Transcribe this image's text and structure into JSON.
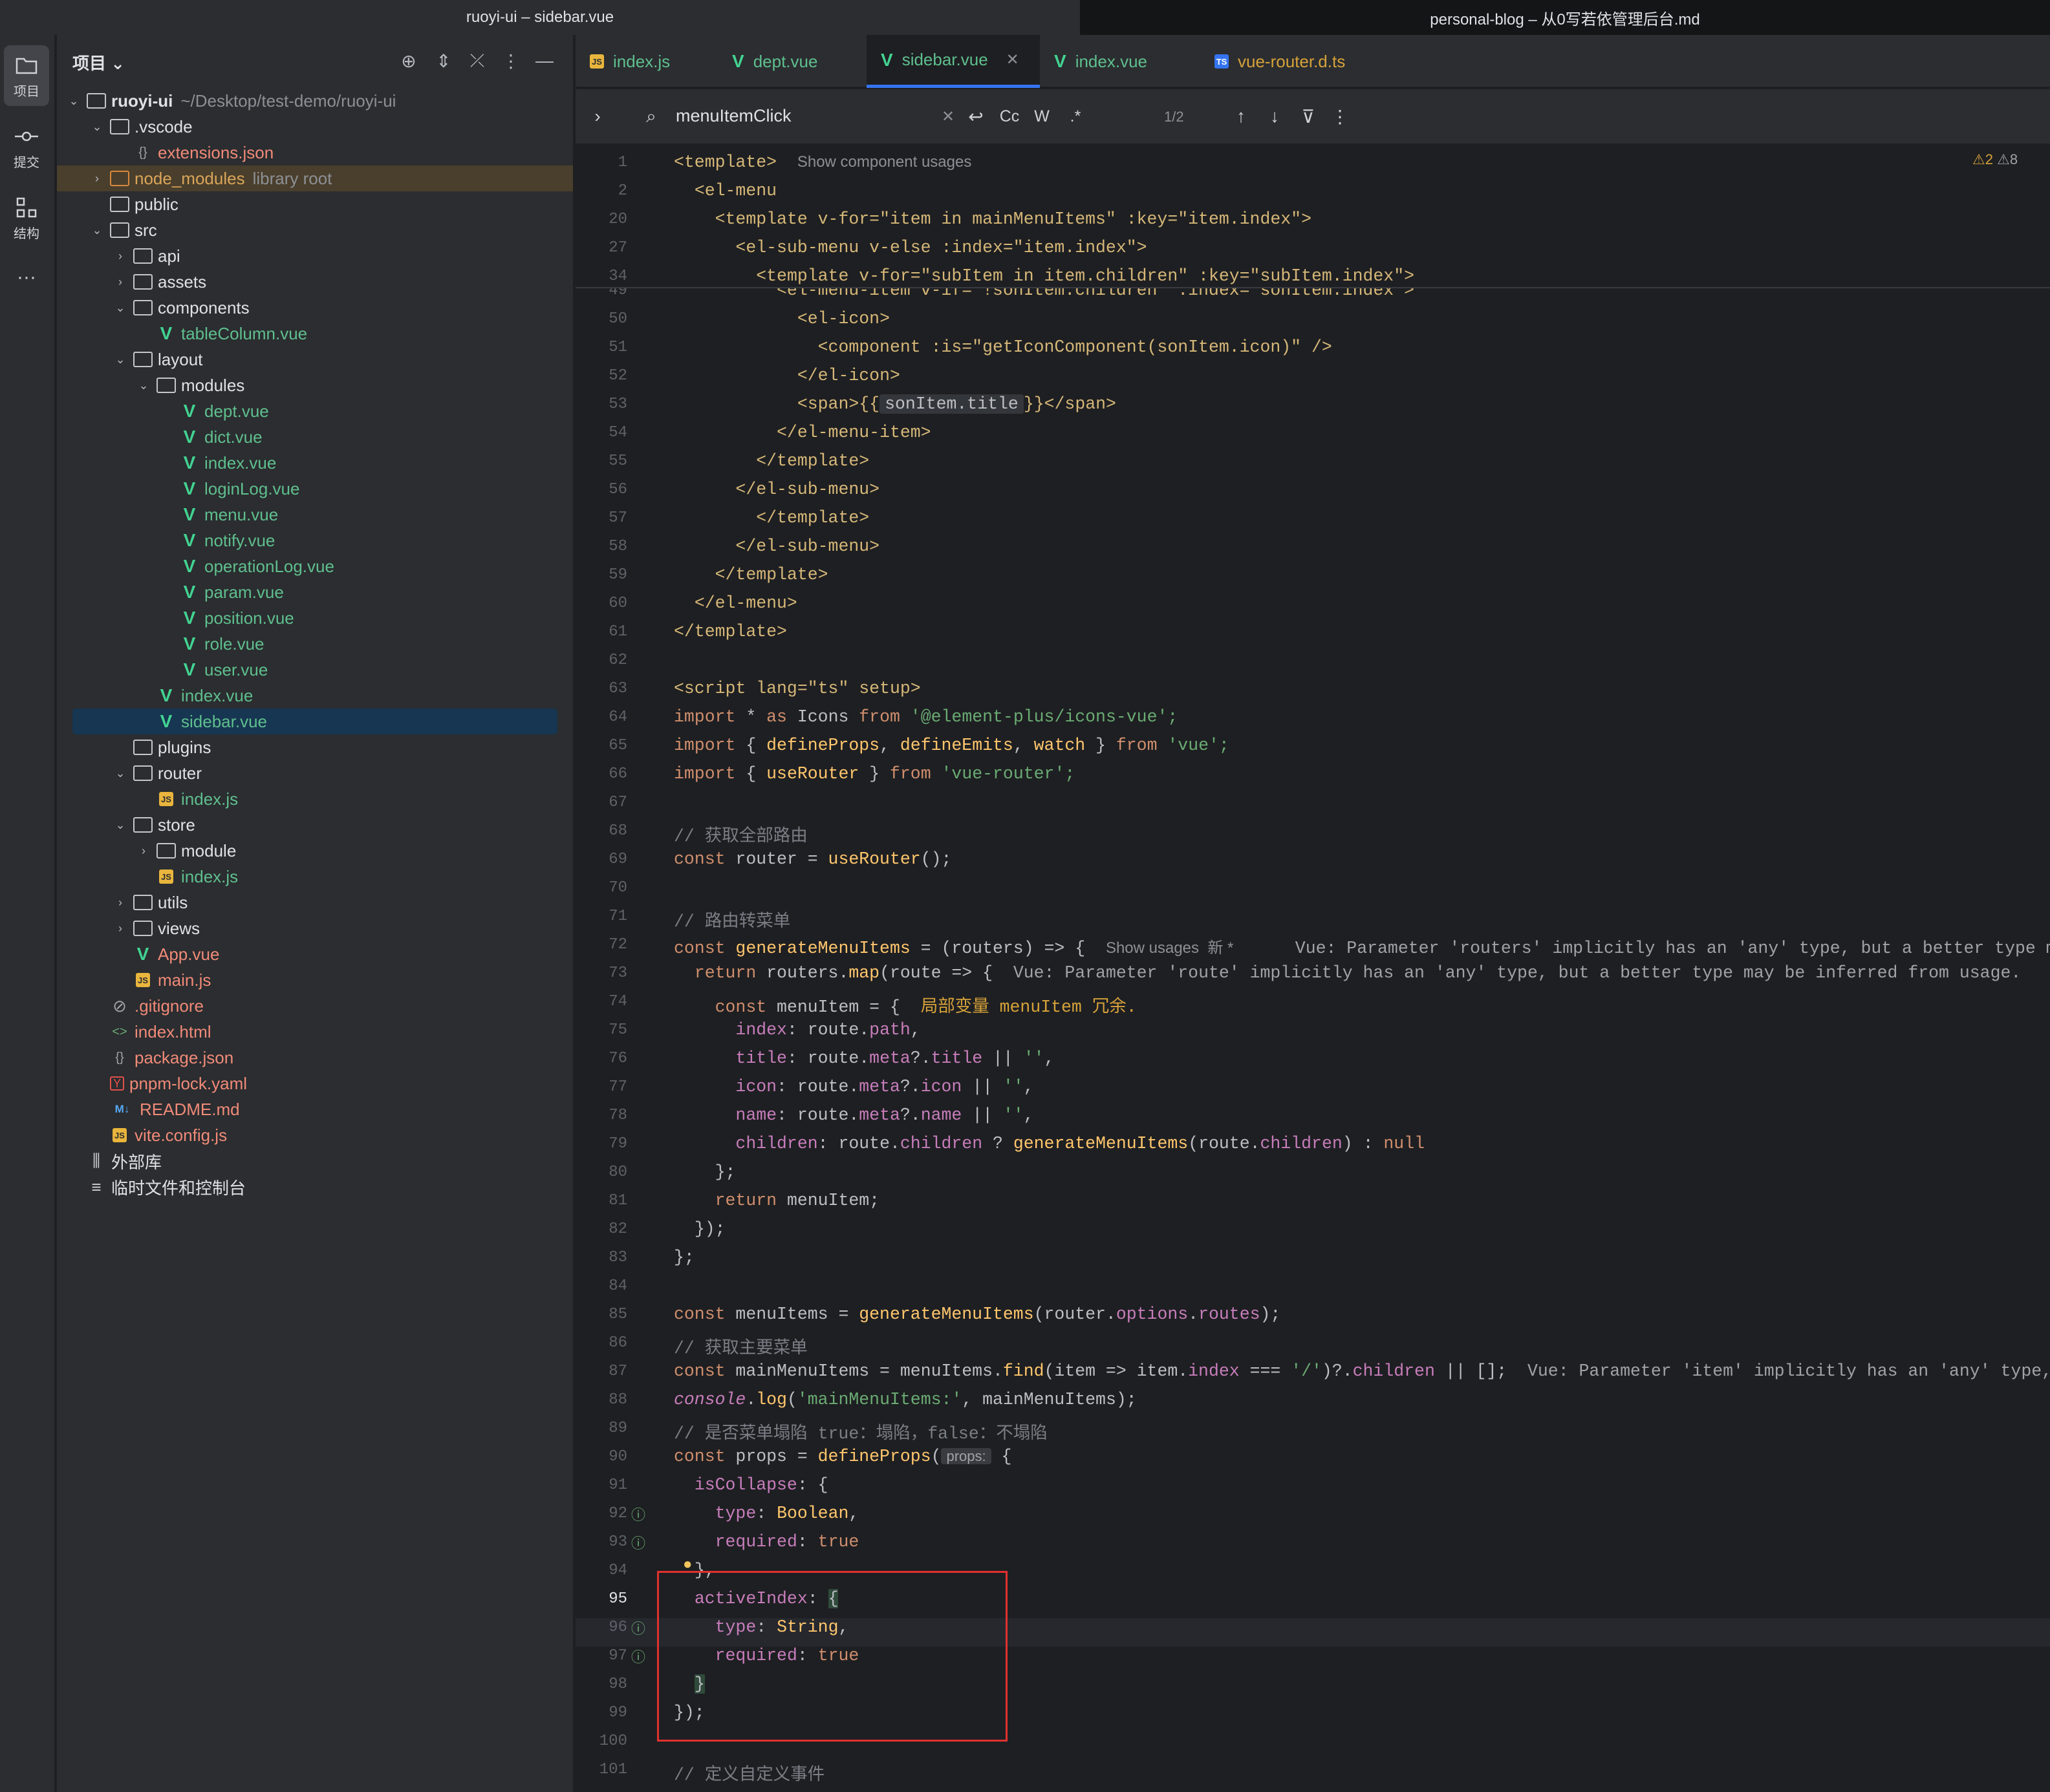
{
  "titlebar": {
    "left": "ruoyi-ui – sidebar.vue",
    "right": "personal-blog – 从0写若依管理后台.md"
  },
  "strip": {
    "project": "项目",
    "commit": "提交",
    "structure": "结构",
    "more": "···"
  },
  "panel": {
    "title": "项目 ⌄"
  },
  "tree": [
    {
      "name": "ruoyi-ui",
      "extra": "~/Desktop/test-demo/ruoyi-ui"
    },
    {
      "name": ".vscode"
    },
    {
      "name": "extensions.json"
    },
    {
      "name": "node_modules",
      "extra": "library root"
    },
    {
      "name": "public"
    },
    {
      "name": "src"
    },
    {
      "name": "api"
    },
    {
      "name": "assets"
    },
    {
      "name": "components"
    },
    {
      "name": "tableColumn.vue"
    },
    {
      "name": "layout"
    },
    {
      "name": "modules"
    },
    {
      "name": "dept.vue"
    },
    {
      "name": "dict.vue"
    },
    {
      "name": "index.vue"
    },
    {
      "name": "loginLog.vue"
    },
    {
      "name": "menu.vue"
    },
    {
      "name": "notify.vue"
    },
    {
      "name": "operationLog.vue"
    },
    {
      "name": "param.vue"
    },
    {
      "name": "position.vue"
    },
    {
      "name": "role.vue"
    },
    {
      "name": "user.vue"
    },
    {
      "name": "index.vue"
    },
    {
      "name": "sidebar.vue"
    },
    {
      "name": "plugins"
    },
    {
      "name": "router"
    },
    {
      "name": "index.js"
    },
    {
      "name": "store"
    },
    {
      "name": "module"
    },
    {
      "name": "index.js"
    },
    {
      "name": "utils"
    },
    {
      "name": "views"
    },
    {
      "name": "App.vue"
    },
    {
      "name": "main.js"
    },
    {
      "name": ".gitignore"
    },
    {
      "name": "index.html"
    },
    {
      "name": "package.json"
    },
    {
      "name": "pnpm-lock.yaml"
    },
    {
      "name": "README.md"
    },
    {
      "name": "vite.config.js"
    },
    {
      "name": "外部库"
    },
    {
      "name": "临时文件和控制台"
    }
  ],
  "tabs": [
    "index.js",
    "dept.vue",
    "sidebar.vue",
    "index.vue",
    "vue-router.d.ts"
  ],
  "find": {
    "query": "menuItemClick",
    "count": "1/2",
    "case": "Cc",
    "word": "W",
    "regex": ".*"
  },
  "inspections": {
    "warnings": "2",
    "weak": "8"
  },
  "lines": {
    "l1": "1",
    "l2": "2",
    "l20": "20",
    "l27": "27",
    "l34": "34",
    "l49": "49",
    "l50": "50",
    "l51": "51",
    "l52": "52",
    "l53": "53",
    "l54": "54",
    "l55": "55",
    "l56": "56",
    "l57": "57",
    "l58": "58",
    "l59": "59",
    "l60": "60",
    "l61": "61",
    "l62": "62",
    "l63": "63",
    "l64": "64",
    "l65": "65",
    "l66": "66",
    "l67": "67",
    "l68": "68",
    "l69": "69",
    "l70": "70",
    "l71": "71",
    "l72": "72",
    "l73": "73",
    "l74": "74",
    "l75": "75",
    "l76": "76",
    "l77": "77",
    "l78": "78",
    "l79": "79",
    "l80": "80",
    "l81": "81",
    "l82": "82",
    "l83": "83",
    "l84": "84",
    "l85": "85",
    "l86": "86",
    "l87": "87",
    "l88": "88",
    "l89": "89",
    "l90": "90",
    "l91": "91",
    "l92": "92",
    "l93": "93",
    "l94": "94",
    "l95": "95",
    "l96": "96",
    "l97": "97",
    "l98": "98",
    "l99": "99",
    "l100": "100",
    "l101": "101"
  },
  "code": {
    "s1a": "<template>",
    "s1h": "Show component usages",
    "s2": "<el-menu",
    "s20": "<template v-for=\"item in mainMenuItems\" :key=\"item.index\">",
    "s27": "<el-sub-menu v-else :index=\"item.index\">",
    "s34": "<template v-for=\"subItem in item.children\" :key=\"subItem.index\">",
    "s49": "<el-menu-item v-if=\"!sonItem.children\" :index=\"sonItem.index\">",
    "s50": "<el-icon>",
    "s51": "<component :is=\"getIconComponent(sonItem.icon)\" />",
    "s52": "</el-icon>",
    "s53a": "<span>{{",
    "s53b": "sonItem.title",
    "s53c": "}}</span>",
    "s54": "</el-menu-item>",
    "s55": "</template>",
    "s56": "</el-sub-menu>",
    "s57": "</template>",
    "s58": "</el-sub-menu>",
    "s59": "</template>",
    "s60": "</el-menu>",
    "s61": "</template>",
    "s63": "<script lang=\"ts\" setup>",
    "s64a": "import",
    "s64b": " * ",
    "s64c": "as",
    "s64d": " Icons ",
    "s64e": "from",
    "s64f": " '@element-plus/icons-vue';",
    "s65a": "import",
    "s65b": " { ",
    "s65c": "defineProps",
    "s65d": ", ",
    "s65e": "defineEmits",
    "s65f": ", ",
    "s65g": "watch",
    "s65h": " } ",
    "s65i": "from",
    "s65j": " 'vue';",
    "s66a": "import",
    "s66b": " { ",
    "s66c": "useRouter",
    "s66d": " } ",
    "s66e": "from",
    "s66f": " 'vue-router';",
    "s68": "// 获取全部路由",
    "s69a": "const",
    "s69b": " router = ",
    "s69c": "useRouter",
    "s69d": "();",
    "s71": "// 路由转菜单",
    "s72a": "const",
    "s72b": " generateMenuItems",
    "s72c": " = (routers) => {",
    "s72h": "Show usages  新 *",
    "s72w": "Vue: Parameter 'routers' implicitly has an 'any' type, but a better type may be",
    "s73a": "return",
    "s73b": " routers.",
    "s73c": "map",
    "s73d": "(route => {",
    "s73w": "Vue: Parameter 'route' implicitly has an 'any' type, but a better type may be inferred from usage.",
    "s74a": "const",
    "s74b": " menuItem",
    "s74c": " = {",
    "s74w": "局部变量 menuItem 冗余.",
    "s75a": "index",
    "s75b": ": route.",
    "s75c": "path",
    "s75d": ",",
    "s76a": "title",
    "s76b": ": route.",
    "s76c": "meta",
    "s76d": "?.",
    "s76e": "title",
    "s76f": " || ",
    "s76g": "''",
    "s76h": ",",
    "s77a": "icon",
    "s77b": ": route.",
    "s77c": "meta",
    "s77d": "?.",
    "s77e": "icon",
    "s77f": " || ",
    "s77g": "''",
    "s77h": ",",
    "s78a": "name",
    "s78b": ": route.",
    "s78c": "meta",
    "s78d": "?.",
    "s78e": "name",
    "s78f": " || ",
    "s78g": "''",
    "s78h": ",",
    "s79a": "children",
    "s79b": ": route.",
    "s79c": "children",
    "s79d": " ? ",
    "s79e": "generateMenuItems",
    "s79f": "(route.",
    "s79g": "children",
    "s79h": ") : ",
    "s79i": "null",
    "s80": "};",
    "s81a": "return",
    "s81b": " menuItem;",
    "s82": "});",
    "s83": "};",
    "s85a": "const",
    "s85b": " menuItems = ",
    "s85c": "generateMenuItems",
    "s85d": "(router.",
    "s85e": "options",
    "s85f": ".",
    "s85g": "routes",
    "s85h": ");",
    "s86": "// 获取主要菜单",
    "s87a": "const",
    "s87b": " mainMenuItems = menuItems.",
    "s87c": "find",
    "s87d": "(item => item.",
    "s87e": "index",
    "s87f": " === ",
    "s87g": "'/'",
    "s87h": ")?.",
    "s87i": "children",
    "s87j": " || [];",
    "s87w": "Vue: Parameter 'item' implicitly has an 'any' type, but a",
    "s88a": "console",
    "s88b": ".",
    "s88c": "log",
    "s88d": "(",
    "s88e": "'mainMenuItems:'",
    "s88f": ", mainMenuItems);",
    "s89": "// 是否菜单塌陷 true：塌陷，false：不塌陷",
    "s90a": "const",
    "s90b": " props = ",
    "s90c": "defineProps",
    "s90d": "(",
    "s90e": "props:",
    "s90f": " {",
    "s91a": "isCollapse",
    "s91b": ": {",
    "s92a": "type",
    "s92b": ": ",
    "s92c": "Boolean",
    "s92d": ",",
    "s93a": "required",
    "s93b": ": ",
    "s93c": "true",
    "s94": "},",
    "s95a": "activeIndex",
    "s95b": ": ",
    "s95c": "{",
    "s96a": "type",
    "s96b": ": ",
    "s96c": "String",
    "s96d": ",",
    "s97a": "required",
    "s97b": ": ",
    "s97c": "true",
    "s98": "}",
    "s99": "});",
    "s101": "// 定义自定义事件"
  }
}
